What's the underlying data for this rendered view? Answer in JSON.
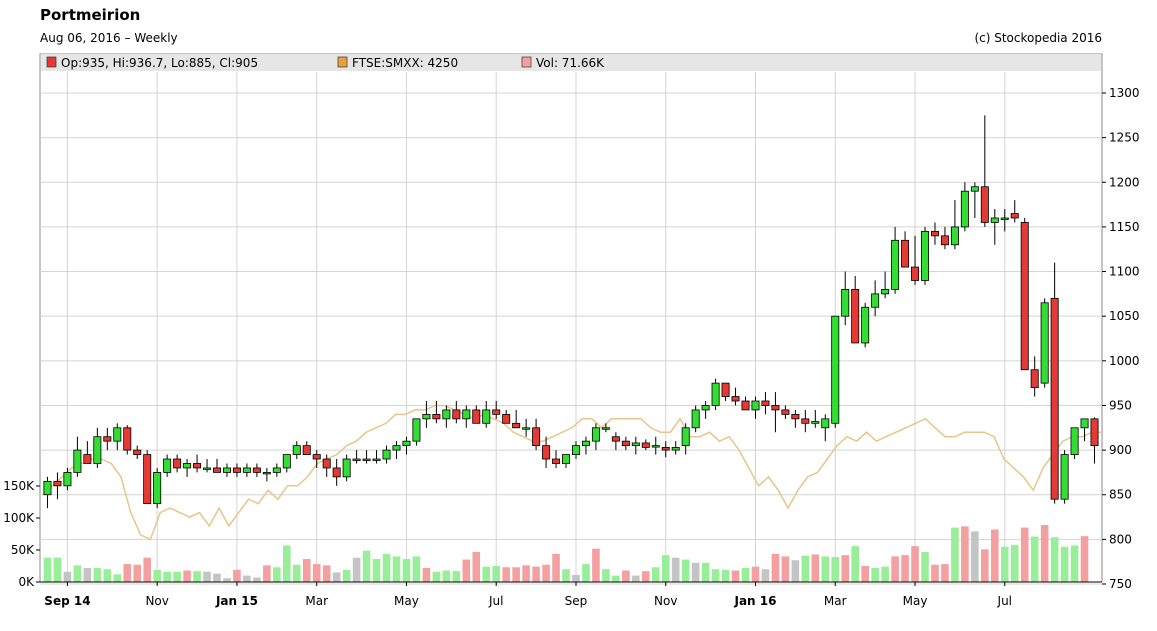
{
  "chart_data": {
    "type": "candlestick",
    "title": "Portmeirion",
    "subtitle": "Aug 06, 2016 – Weekly",
    "copyright": "(c) Stockopedia 2016",
    "legend": [
      {
        "name": "Op:935, Hi:936.7, Lo:885, Cl:905",
        "color": "#e53935"
      },
      {
        "name": "FTSE:SMXX: 4250",
        "color": "#e8a23a"
      },
      {
        "name": "Vol: 71.66K",
        "color": "#f4a0a0"
      }
    ],
    "price_axis": {
      "side": "right",
      "min": 750,
      "max": 1300,
      "ticks": [
        750,
        800,
        850,
        900,
        950,
        1000,
        1050,
        1100,
        1150,
        1200,
        1250,
        1300
      ]
    },
    "volume_axis": {
      "side": "left",
      "min": 0,
      "max": 150000,
      "ticks": [
        0,
        50000,
        100000,
        150000
      ],
      "tick_labels": [
        "0K",
        "50K",
        "100K",
        "150K"
      ]
    },
    "x_labels": [
      {
        "label": "Sep 14",
        "index": 2,
        "bold": true
      },
      {
        "label": "Nov",
        "index": 11,
        "bold": false
      },
      {
        "label": "Jan 15",
        "index": 19,
        "bold": true
      },
      {
        "label": "Mar",
        "index": 27,
        "bold": false
      },
      {
        "label": "May",
        "index": 36,
        "bold": false
      },
      {
        "label": "Jul",
        "index": 45,
        "bold": false
      },
      {
        "label": "Sep",
        "index": 53,
        "bold": false
      },
      {
        "label": "Nov",
        "index": 62,
        "bold": false
      },
      {
        "label": "Jan 16",
        "index": 71,
        "bold": true
      },
      {
        "label": "Mar",
        "index": 79,
        "bold": false
      },
      {
        "label": "May",
        "index": 87,
        "bold": false
      },
      {
        "label": "Jul",
        "index": 96,
        "bold": false
      }
    ],
    "grid": true,
    "candles": [
      [
        850,
        870,
        835,
        865
      ],
      [
        865,
        875,
        845,
        860
      ],
      [
        860,
        880,
        855,
        875
      ],
      [
        875,
        915,
        870,
        900
      ],
      [
        895,
        910,
        885,
        885
      ],
      [
        885,
        925,
        880,
        915
      ],
      [
        915,
        925,
        900,
        910
      ],
      [
        910,
        930,
        900,
        925
      ],
      [
        925,
        928,
        895,
        900
      ],
      [
        900,
        905,
        890,
        895
      ],
      [
        895,
        900,
        840,
        840
      ],
      [
        840,
        880,
        835,
        875
      ],
      [
        875,
        895,
        870,
        890
      ],
      [
        890,
        895,
        875,
        880
      ],
      [
        880,
        890,
        870,
        885
      ],
      [
        885,
        895,
        875,
        880
      ],
      [
        880,
        890,
        875,
        880
      ],
      [
        880,
        890,
        875,
        875
      ],
      [
        875,
        885,
        870,
        880
      ],
      [
        880,
        885,
        870,
        875
      ],
      [
        875,
        885,
        870,
        880
      ],
      [
        880,
        885,
        870,
        875
      ],
      [
        875,
        880,
        865,
        875
      ],
      [
        875,
        885,
        870,
        880
      ],
      [
        880,
        895,
        875,
        895
      ],
      [
        895,
        910,
        890,
        905
      ],
      [
        905,
        910,
        895,
        895
      ],
      [
        895,
        900,
        880,
        890
      ],
      [
        890,
        895,
        870,
        880
      ],
      [
        880,
        890,
        860,
        870
      ],
      [
        870,
        895,
        865,
        890
      ],
      [
        890,
        900,
        885,
        890
      ],
      [
        890,
        900,
        885,
        890
      ],
      [
        890,
        900,
        885,
        890
      ],
      [
        890,
        905,
        885,
        900
      ],
      [
        900,
        910,
        890,
        905
      ],
      [
        905,
        915,
        895,
        910
      ],
      [
        910,
        935,
        905,
        935
      ],
      [
        935,
        955,
        925,
        940
      ],
      [
        940,
        955,
        930,
        935
      ],
      [
        935,
        950,
        925,
        945
      ],
      [
        945,
        955,
        930,
        935
      ],
      [
        935,
        950,
        925,
        945
      ],
      [
        945,
        950,
        930,
        930
      ],
      [
        930,
        955,
        925,
        945
      ],
      [
        945,
        955,
        935,
        940
      ],
      [
        940,
        945,
        930,
        930
      ],
      [
        930,
        945,
        925,
        925
      ],
      [
        925,
        935,
        915,
        925
      ],
      [
        925,
        935,
        900,
        905
      ],
      [
        905,
        915,
        880,
        890
      ],
      [
        890,
        900,
        880,
        885
      ],
      [
        885,
        895,
        880,
        895
      ],
      [
        895,
        910,
        890,
        905
      ],
      [
        905,
        915,
        895,
        910
      ],
      [
        910,
        930,
        900,
        925
      ],
      [
        925,
        930,
        920,
        925
      ],
      [
        915,
        920,
        900,
        910
      ],
      [
        910,
        915,
        900,
        905
      ],
      [
        905,
        915,
        895,
        908
      ],
      [
        908,
        912,
        900,
        903
      ],
      [
        905,
        915,
        895,
        905
      ],
      [
        903,
        910,
        892,
        900
      ],
      [
        900,
        910,
        895,
        903
      ],
      [
        905,
        930,
        895,
        925
      ],
      [
        925,
        950,
        920,
        945
      ],
      [
        945,
        955,
        935,
        950
      ],
      [
        950,
        980,
        945,
        975
      ],
      [
        975,
        975,
        955,
        960
      ],
      [
        960,
        970,
        950,
        955
      ],
      [
        955,
        960,
        945,
        945
      ],
      [
        945,
        960,
        935,
        955
      ],
      [
        955,
        965,
        940,
        950
      ],
      [
        950,
        965,
        920,
        945
      ],
      [
        945,
        950,
        935,
        940
      ],
      [
        940,
        945,
        925,
        935
      ],
      [
        935,
        945,
        920,
        930
      ],
      [
        930,
        945,
        925,
        932
      ],
      [
        925,
        940,
        910,
        935
      ],
      [
        930,
        1050,
        925,
        1050
      ],
      [
        1050,
        1100,
        1040,
        1080
      ],
      [
        1080,
        1095,
        1020,
        1020
      ],
      [
        1020,
        1065,
        1015,
        1060
      ],
      [
        1060,
        1090,
        1050,
        1075
      ],
      [
        1075,
        1100,
        1070,
        1080
      ],
      [
        1080,
        1150,
        1075,
        1135
      ],
      [
        1135,
        1145,
        1105,
        1105
      ],
      [
        1105,
        1140,
        1085,
        1090
      ],
      [
        1090,
        1150,
        1085,
        1145
      ],
      [
        1145,
        1155,
        1130,
        1140
      ],
      [
        1140,
        1150,
        1125,
        1130
      ],
      [
        1130,
        1180,
        1125,
        1150
      ],
      [
        1150,
        1200,
        1145,
        1190
      ],
      [
        1190,
        1200,
        1160,
        1195
      ],
      [
        1195,
        1275,
        1150,
        1155
      ],
      [
        1155,
        1170,
        1130,
        1160
      ],
      [
        1160,
        1170,
        1145,
        1160
      ],
      [
        1165,
        1180,
        1155,
        1160
      ],
      [
        1155,
        1160,
        1050,
        990
      ],
      [
        990,
        1005,
        960,
        970
      ],
      [
        975,
        1070,
        970,
        1065
      ],
      [
        1070,
        1110,
        840,
        845
      ],
      [
        845,
        900,
        840,
        895
      ],
      [
        895,
        925,
        890,
        925
      ],
      [
        925,
        935,
        910,
        935
      ],
      [
        935,
        936.7,
        885,
        905
      ]
    ],
    "volumes": [
      38000,
      38000,
      16000,
      26000,
      22000,
      22000,
      20000,
      12000,
      28000,
      27000,
      38000,
      19000,
      16000,
      16000,
      18000,
      17000,
      16000,
      13000,
      6000,
      19000,
      10000,
      7000,
      26000,
      23000,
      57000,
      27000,
      36000,
      28000,
      26000,
      15000,
      19000,
      38000,
      49000,
      36000,
      44000,
      40000,
      36000,
      40000,
      22000,
      16000,
      18000,
      17000,
      35000,
      47000,
      24000,
      25000,
      23000,
      23000,
      26000,
      24000,
      27000,
      44000,
      20000,
      11000,
      28000,
      52000,
      20000,
      10000,
      18000,
      10000,
      17000,
      23000,
      42000,
      38000,
      35000,
      30000,
      30000,
      20000,
      19000,
      18000,
      22000,
      24000,
      20000,
      44000,
      40000,
      34000,
      41000,
      43000,
      40000,
      39000,
      42000,
      56000,
      25000,
      22000,
      24000,
      40000,
      42000,
      56000,
      47000,
      27000,
      28000,
      85000,
      87000,
      79000,
      51000,
      82000,
      55000,
      58000,
      85000,
      71000,
      89000,
      70000,
      55000,
      57000,
      71660
    ],
    "volume_colors": [
      "g",
      "g",
      "x",
      "g",
      "x",
      "g",
      "g",
      "g",
      "r",
      "r",
      "r",
      "g",
      "g",
      "g",
      "r",
      "g",
      "x",
      "x",
      "x",
      "r",
      "x",
      "x",
      "r",
      "g",
      "g",
      "g",
      "r",
      "r",
      "r",
      "x",
      "g",
      "x",
      "g",
      "g",
      "g",
      "g",
      "g",
      "g",
      "r",
      "g",
      "g",
      "g",
      "r",
      "r",
      "g",
      "g",
      "r",
      "r",
      "r",
      "r",
      "r",
      "r",
      "g",
      "x",
      "g",
      "r",
      "g",
      "g",
      "r",
      "x",
      "r",
      "g",
      "g",
      "x",
      "g",
      "x",
      "g",
      "g",
      "g",
      "r",
      "g",
      "r",
      "x",
      "r",
      "r",
      "x",
      "g",
      "r",
      "g",
      "g",
      "r",
      "g",
      "r",
      "g",
      "g",
      "r",
      "r",
      "r",
      "g",
      "r",
      "r",
      "g",
      "r",
      "x",
      "r",
      "r",
      "g",
      "g",
      "r",
      "g",
      "r",
      "g",
      "g",
      "g",
      "r"
    ],
    "ftse_series": [
      850,
      860,
      870,
      880,
      885,
      890,
      890,
      885,
      870,
      830,
      805,
      800,
      830,
      835,
      830,
      825,
      830,
      815,
      835,
      815,
      830,
      845,
      840,
      855,
      845,
      860,
      860,
      870,
      885,
      890,
      895,
      905,
      910,
      920,
      925,
      930,
      940,
      940,
      945,
      945,
      950,
      950,
      945,
      940,
      935,
      940,
      935,
      930,
      920,
      915,
      910,
      910,
      915,
      920,
      925,
      935,
      935,
      925,
      935,
      935,
      935,
      935,
      925,
      920,
      920,
      935,
      915,
      915,
      920,
      910,
      915,
      900,
      880,
      860,
      870,
      855,
      835,
      855,
      870,
      875,
      890,
      905,
      915,
      910,
      920,
      910,
      915,
      920,
      925,
      930,
      935,
      925,
      915,
      915,
      920,
      920,
      920,
      915,
      890,
      880,
      870,
      855,
      880,
      895,
      910,
      915,
      915,
      920,
      920
    ]
  }
}
